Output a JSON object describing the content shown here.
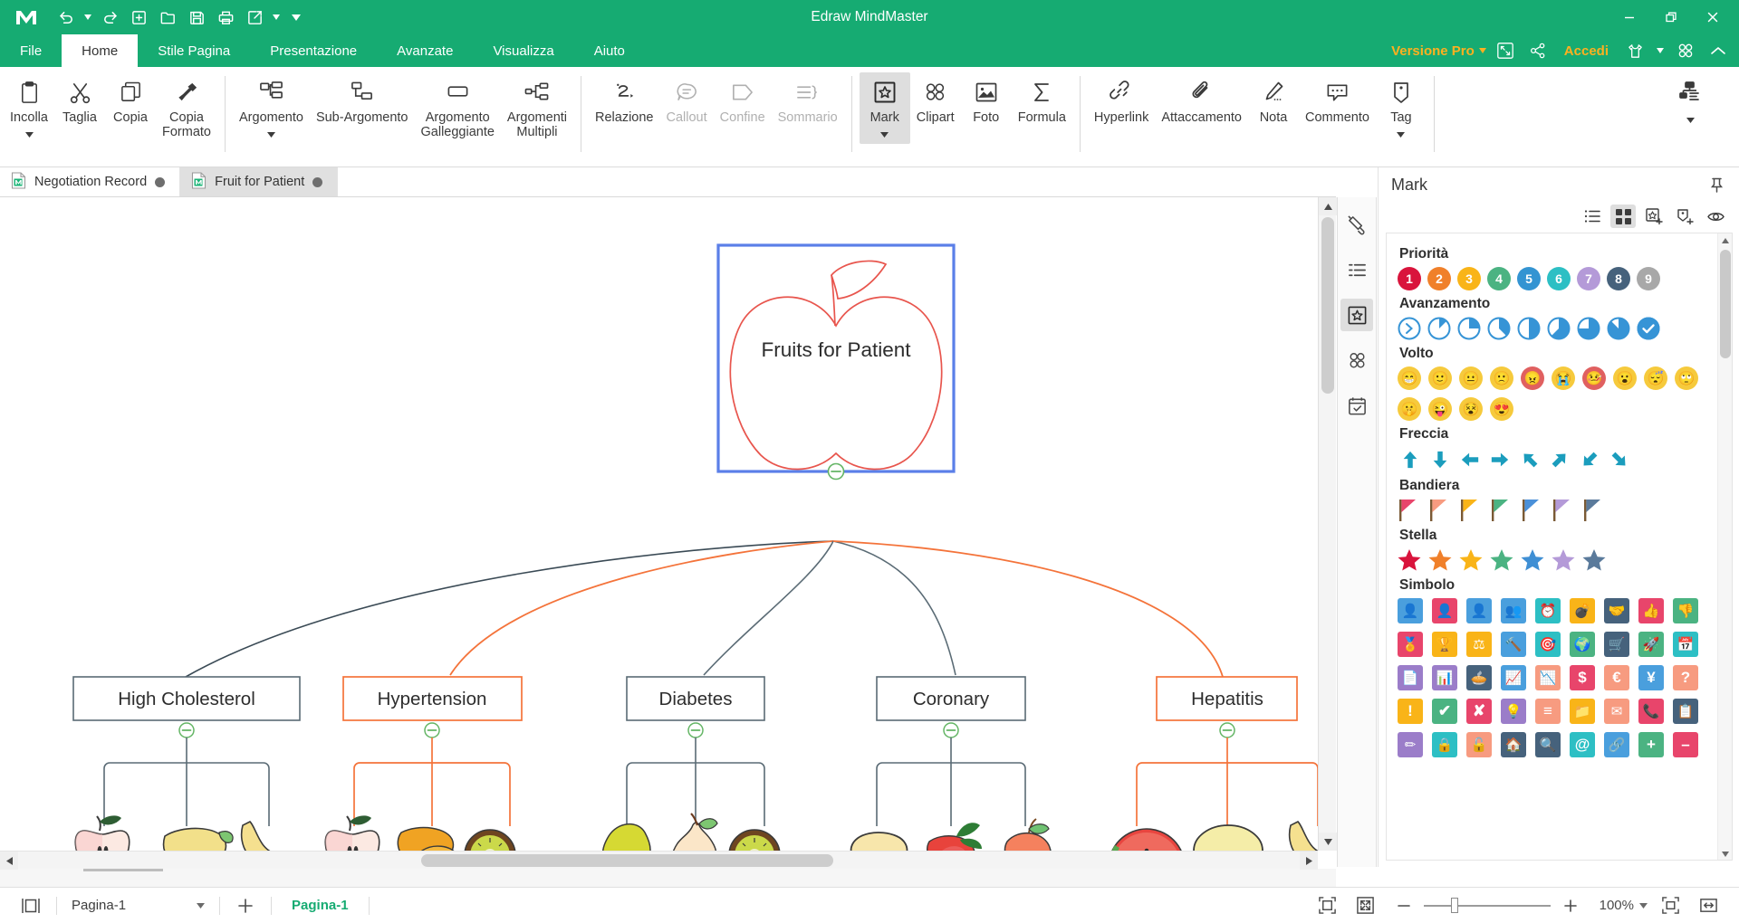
{
  "window": {
    "title": "Edraw MindMaster",
    "minimize_label": "–",
    "restore_label": "❐",
    "close_label": "✕"
  },
  "quick_access": [
    {
      "name": "undo-button",
      "label": "Undo"
    },
    {
      "name": "undo-dropdown",
      "label": "▾"
    },
    {
      "name": "redo-button",
      "label": "Redo"
    },
    {
      "name": "new-button",
      "label": "New"
    },
    {
      "name": "open-button",
      "label": "Open"
    },
    {
      "name": "save-button",
      "label": "Save"
    },
    {
      "name": "print-button",
      "label": "Print"
    },
    {
      "name": "export-button",
      "label": "Export"
    },
    {
      "name": "export-dropdown",
      "label": "▾"
    },
    {
      "name": "qat-more",
      "label": "▾"
    }
  ],
  "menu": {
    "items": [
      {
        "label": "File",
        "active": false
      },
      {
        "label": "Home",
        "active": true
      },
      {
        "label": "Stile Pagina",
        "active": false
      },
      {
        "label": "Presentazione",
        "active": false
      },
      {
        "label": "Avanzate",
        "active": false
      },
      {
        "label": "Visualizza",
        "active": false
      },
      {
        "label": "Aiuto",
        "active": false
      }
    ],
    "pro_label": "Versione Pro",
    "signin_label": "Accedi"
  },
  "ribbon": {
    "groups": [
      {
        "name": "clipboard",
        "buttons": [
          {
            "label": "Incolla",
            "icon": "paste-icon",
            "caret": true,
            "active": false,
            "disabled": false
          },
          {
            "label": "Taglia",
            "icon": "scissors-icon",
            "caret": false,
            "active": false,
            "disabled": false
          },
          {
            "label": "Copia",
            "icon": "copy-icon",
            "caret": false,
            "active": false,
            "disabled": false
          },
          {
            "label": "Copia\nFormato",
            "icon": "format-painter-icon",
            "caret": false,
            "active": false,
            "disabled": false
          }
        ]
      },
      {
        "name": "topics",
        "buttons": [
          {
            "label": "Argomento",
            "icon": "topic-icon",
            "caret": true,
            "active": false,
            "disabled": false
          },
          {
            "label": "Sub-Argomento",
            "icon": "subtopic-icon",
            "caret": false,
            "active": false,
            "disabled": false
          },
          {
            "label": "Argomento\nGalleggiante",
            "icon": "floating-topic-icon",
            "caret": false,
            "active": false,
            "disabled": false
          },
          {
            "label": "Argomenti\nMultipli",
            "icon": "multiple-topics-icon",
            "caret": false,
            "active": false,
            "disabled": false
          }
        ]
      },
      {
        "name": "relations",
        "buttons": [
          {
            "label": "Relazione",
            "icon": "relation-icon",
            "caret": false,
            "active": false,
            "disabled": false
          },
          {
            "label": "Callout",
            "icon": "callout-icon",
            "caret": false,
            "active": false,
            "disabled": true
          },
          {
            "label": "Confine",
            "icon": "boundary-icon",
            "caret": false,
            "active": false,
            "disabled": true
          },
          {
            "label": "Sommario",
            "icon": "summary-icon",
            "caret": false,
            "active": false,
            "disabled": true
          }
        ]
      },
      {
        "name": "insert",
        "buttons": [
          {
            "label": "Mark",
            "icon": "mark-icon",
            "caret": true,
            "active": true,
            "disabled": false
          },
          {
            "label": "Clipart",
            "icon": "clipart-icon",
            "caret": false,
            "active": false,
            "disabled": false
          },
          {
            "label": "Foto",
            "icon": "photo-icon",
            "caret": false,
            "active": false,
            "disabled": false
          },
          {
            "label": "Formula",
            "icon": "formula-icon",
            "caret": false,
            "active": false,
            "disabled": false
          }
        ]
      },
      {
        "name": "annotate",
        "buttons": [
          {
            "label": "Hyperlink",
            "icon": "hyperlink-icon",
            "caret": false,
            "active": false,
            "disabled": false
          },
          {
            "label": "Attaccamento",
            "icon": "attachment-icon",
            "caret": false,
            "active": false,
            "disabled": false
          },
          {
            "label": "Nota",
            "icon": "note-icon",
            "caret": false,
            "active": false,
            "disabled": false
          },
          {
            "label": "Commento",
            "icon": "comment-icon",
            "caret": false,
            "active": false,
            "disabled": false
          },
          {
            "label": "Tag",
            "icon": "tag-icon",
            "caret": true,
            "active": false,
            "disabled": false
          }
        ]
      },
      {
        "name": "layout",
        "buttons": [
          {
            "label": "",
            "icon": "layout-icon",
            "caret": true,
            "active": false,
            "disabled": false
          }
        ]
      }
    ]
  },
  "doc_tabs": [
    {
      "label": "Negotiation Record",
      "active": false
    },
    {
      "label": "Fruit for Patient",
      "active": true
    }
  ],
  "mindmap": {
    "root": {
      "label": "Fruits for Patient",
      "selected": true,
      "border_color": "#5b7fe8",
      "shape_color": "#e8554d"
    },
    "branches": [
      {
        "label": "High Cholesterol",
        "color": "#5a6b75",
        "fruits": [
          "apple-half",
          "mango",
          "banana"
        ]
      },
      {
        "label": "Hypertension",
        "color": "#f4733a",
        "fruits": [
          "apple-half",
          "papaya",
          "kiwi"
        ]
      },
      {
        "label": "Diabetes",
        "color": "#5a6b75",
        "fruits": [
          "pear-green",
          "pear",
          "kiwi"
        ]
      },
      {
        "label": "Coronary",
        "color": "#5a6b75",
        "fruits": [
          "lemon",
          "strawberry",
          "peach"
        ]
      },
      {
        "label": "Hepatitis",
        "color": "#f4733a",
        "fruits": [
          "watermelon",
          "melon",
          "banana"
        ]
      }
    ]
  },
  "mark_panel": {
    "title": "Mark",
    "toolbar": [
      {
        "name": "list-view-icon",
        "active": false
      },
      {
        "name": "grid-view-icon",
        "active": true
      },
      {
        "name": "add-mark-icon",
        "active": false
      },
      {
        "name": "add-tag-icon",
        "active": false
      },
      {
        "name": "eye-icon",
        "active": false
      }
    ],
    "sections": [
      {
        "title": "Priorità",
        "type": "priority",
        "items": [
          {
            "label": "1",
            "color": "#d9143c"
          },
          {
            "label": "2",
            "color": "#f0802a"
          },
          {
            "label": "3",
            "color": "#f9b418"
          },
          {
            "label": "4",
            "color": "#4bb382"
          },
          {
            "label": "5",
            "color": "#3494d2"
          },
          {
            "label": "6",
            "color": "#2dbfc4"
          },
          {
            "label": "7",
            "color": "#b49ad8"
          },
          {
            "label": "8",
            "color": "#46627c"
          },
          {
            "label": "9",
            "color": "#a8a8a8"
          }
        ]
      },
      {
        "title": "Avanzamento",
        "type": "progress",
        "color": "#3694d6",
        "items": [
          0,
          12.5,
          25,
          37.5,
          50,
          62.5,
          75,
          87.5,
          100
        ]
      },
      {
        "title": "Volto",
        "type": "face",
        "items": [
          {
            "name": "grin-face",
            "color": "#f6ca3c",
            "glyph": "😁"
          },
          {
            "name": "smile-face",
            "color": "#f6ca3c",
            "glyph": "🙂"
          },
          {
            "name": "neutral-face",
            "color": "#f6ca3c",
            "glyph": "😐"
          },
          {
            "name": "sad-face",
            "color": "#f6ca3c",
            "glyph": "🙁"
          },
          {
            "name": "angry-face",
            "color": "#e06060",
            "glyph": "😠"
          },
          {
            "name": "crying-face",
            "color": "#f6ca3c",
            "glyph": "😭"
          },
          {
            "name": "sick-face",
            "color": "#e06060",
            "glyph": "🤒"
          },
          {
            "name": "surprised-face",
            "color": "#f6ca3c",
            "glyph": "😮"
          },
          {
            "name": "sleeping-face",
            "color": "#f6ca3c",
            "glyph": "😴"
          },
          {
            "name": "rolling-eyes-face",
            "color": "#f6ca3c",
            "glyph": "🙄"
          },
          {
            "name": "shush-face",
            "color": "#f6ca3c",
            "glyph": "🤫"
          },
          {
            "name": "wink-tongue-face",
            "color": "#f6ca3c",
            "glyph": "😜"
          },
          {
            "name": "dizzy-face",
            "color": "#f6ca3c",
            "glyph": "😵"
          },
          {
            "name": "heart-eyes-face",
            "color": "#f6ca3c",
            "glyph": "😍"
          }
        ]
      },
      {
        "title": "Freccia",
        "type": "arrow",
        "color": "#1b9dbd",
        "items": [
          "up",
          "down",
          "left",
          "right",
          "up-left",
          "up-right",
          "down-left",
          "down-right"
        ]
      },
      {
        "title": "Bandiera",
        "type": "flag",
        "items": [
          "#e8456b",
          "#f79b80",
          "#f9b418",
          "#4bb382",
          "#4a90d9",
          "#b49ad8",
          "#5a7a9b"
        ]
      },
      {
        "title": "Stella",
        "type": "star",
        "items": [
          "#d9143c",
          "#f0802a",
          "#f9b418",
          "#4bb382",
          "#3f8fd4",
          "#b49ad8",
          "#5a7a9b"
        ]
      },
      {
        "title": "Simbolo",
        "type": "symbol",
        "rows": [
          [
            {
              "name": "user-icon",
              "color": "#4a9fdd",
              "glyph": "👤"
            },
            {
              "name": "person-red-icon",
              "color": "#e8456b",
              "glyph": "👤"
            },
            {
              "name": "user-blue-icon",
              "color": "#4a9fdd",
              "glyph": "👤"
            },
            {
              "name": "group-icon",
              "color": "#4a9fdd",
              "glyph": "👥"
            },
            {
              "name": "alarm-clock-icon",
              "color": "#2dbfc4",
              "glyph": "⏰"
            },
            {
              "name": "bomb-icon",
              "color": "#f9b418",
              "glyph": "💣"
            },
            {
              "name": "handshake-icon",
              "color": "#46627c",
              "glyph": "🤝"
            },
            {
              "name": "thumbs-up-icon",
              "color": "#e8456b",
              "glyph": "👍"
            },
            {
              "name": "thumbs-down-icon",
              "color": "#4bb382",
              "glyph": "👎"
            }
          ],
          [
            {
              "name": "medal-icon",
              "color": "#e8456b",
              "glyph": "🏅"
            },
            {
              "name": "trophy-icon",
              "color": "#f9b418",
              "glyph": "🏆"
            },
            {
              "name": "scales-icon",
              "color": "#f9b418",
              "glyph": "⚖"
            },
            {
              "name": "gavel-icon",
              "color": "#4a9fdd",
              "glyph": "🔨"
            },
            {
              "name": "target-icon",
              "color": "#2dbfc4",
              "glyph": "🎯"
            },
            {
              "name": "globe-icon",
              "color": "#4bb382",
              "glyph": "🌍"
            },
            {
              "name": "shopping-cart-icon",
              "color": "#46627c",
              "glyph": "🛒"
            },
            {
              "name": "rocket-icon",
              "color": "#4bb382",
              "glyph": "🚀"
            },
            {
              "name": "calendar-icon",
              "color": "#2dbfc4",
              "glyph": "📅"
            }
          ],
          [
            {
              "name": "document-icon",
              "color": "#9b7dc9",
              "glyph": "📄"
            },
            {
              "name": "bar-chart-icon",
              "color": "#9b7dc9",
              "glyph": "📊"
            },
            {
              "name": "pie-chart-icon",
              "color": "#46627c",
              "glyph": "🥧"
            },
            {
              "name": "line-chart-icon",
              "color": "#4a9fdd",
              "glyph": "📈"
            },
            {
              "name": "area-chart-icon",
              "color": "#f79b80",
              "glyph": "📉"
            },
            {
              "name": "dollar-icon",
              "color": "#e8456b",
              "glyph": "$"
            },
            {
              "name": "euro-icon",
              "color": "#f79b80",
              "glyph": "€"
            },
            {
              "name": "yen-icon",
              "color": "#4a9fdd",
              "glyph": "¥"
            },
            {
              "name": "question-icon",
              "color": "#f79b80",
              "glyph": "?"
            }
          ],
          [
            {
              "name": "exclamation-icon",
              "color": "#f9b418",
              "glyph": "!"
            },
            {
              "name": "check-icon",
              "color": "#4bb382",
              "glyph": "✔"
            },
            {
              "name": "cross-icon",
              "color": "#e8456b",
              "glyph": "✘"
            },
            {
              "name": "idea-icon",
              "color": "#9b7dc9",
              "glyph": "💡"
            },
            {
              "name": "layers-icon",
              "color": "#f79b80",
              "glyph": "≡"
            },
            {
              "name": "folder-icon",
              "color": "#f9b418",
              "glyph": "📁"
            },
            {
              "name": "mail-icon",
              "color": "#f79b80",
              "glyph": "✉"
            },
            {
              "name": "phone-icon",
              "color": "#e8456b",
              "glyph": "📞"
            },
            {
              "name": "notes-icon",
              "color": "#46627c",
              "glyph": "📋"
            }
          ],
          [
            {
              "name": "pencil-icon",
              "color": "#9b7dc9",
              "glyph": "✏"
            },
            {
              "name": "lock-icon",
              "color": "#2dbfc4",
              "glyph": "🔒"
            },
            {
              "name": "unlock-icon",
              "color": "#f79b80",
              "glyph": "🔓"
            },
            {
              "name": "home-icon",
              "color": "#46627c",
              "glyph": "🏠"
            },
            {
              "name": "search-icon",
              "color": "#46627c",
              "glyph": "🔍"
            },
            {
              "name": "at-icon",
              "color": "#2dbfc4",
              "glyph": "@"
            },
            {
              "name": "link-icon",
              "color": "#4a9fdd",
              "glyph": "🔗"
            },
            {
              "name": "plus-icon",
              "color": "#4bb382",
              "glyph": "+"
            },
            {
              "name": "minus-icon",
              "color": "#e8456b",
              "glyph": "–"
            }
          ]
        ]
      }
    ]
  },
  "status_bar": {
    "page_select": "Pagina-1",
    "page_tab": "Pagina-1",
    "add_page_label": "+",
    "zoom_percent": "100%",
    "zoom_minus": "–",
    "zoom_plus": "+"
  }
}
